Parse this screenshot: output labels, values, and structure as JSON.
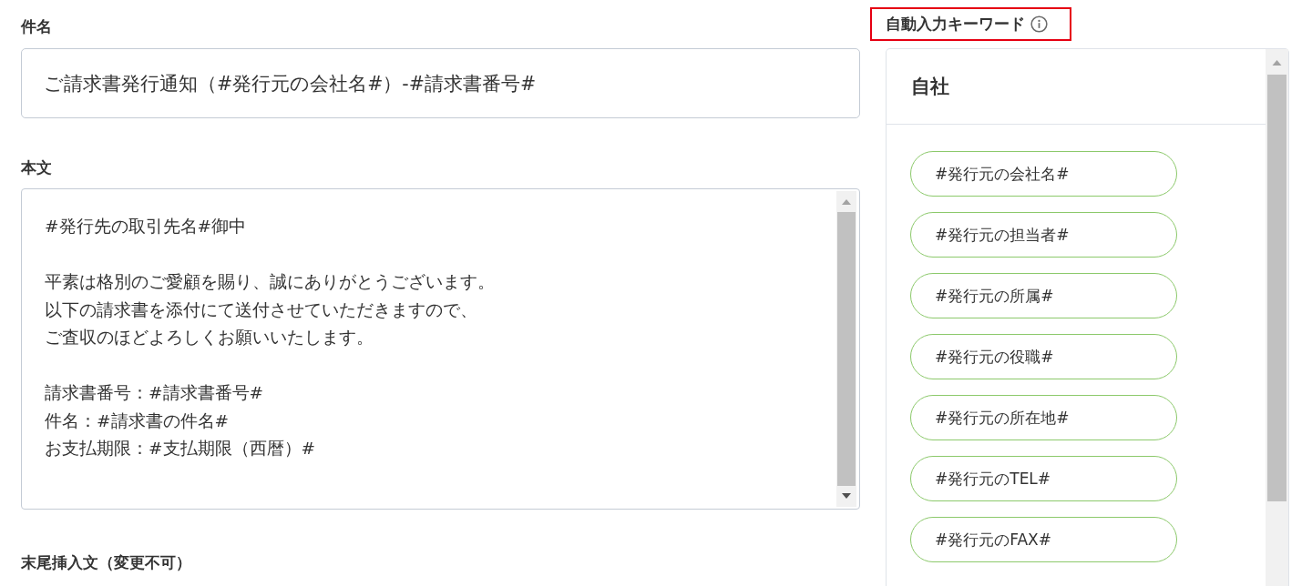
{
  "subject": {
    "label": "件名",
    "value": "ご請求書発行通知（#発行元の会社名#）-#請求書番号#"
  },
  "body": {
    "label": "本文",
    "paragraphs": [
      [
        "#発行先の取引先名#御中"
      ],
      [
        "平素は格別のご愛顧を賜り、誠にありがとうございます。",
        "以下の請求書を添付にて送付させていただきますので、",
        "ご査収のほどよろしくお願いいたします。"
      ],
      [
        "請求書番号：#請求書番号#",
        "件名：#請求書の件名#",
        "お支払期限：#支払期限（西暦）#"
      ]
    ]
  },
  "footer_text": {
    "label": "末尾挿入文（変更不可）"
  },
  "keywords": {
    "heading": "自動入力キーワード",
    "highlighted": true,
    "group": {
      "title": "自社",
      "items": [
        "#発行元の会社名#",
        "#発行元の担当者#",
        "#発行元の所属#",
        "#発行元の役職#",
        "#発行元の所在地#",
        "#発行元のTEL#",
        "#発行元のFAX#"
      ]
    }
  }
}
